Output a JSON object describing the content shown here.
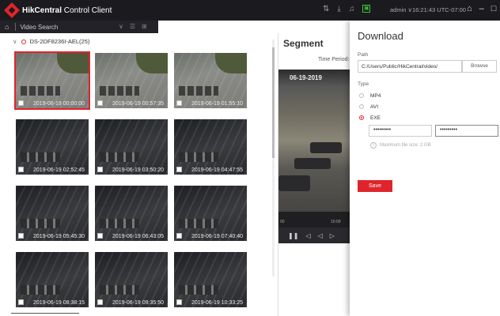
{
  "app": {
    "brand_bold": "HikCentral",
    "brand_rest": " Control Client",
    "user": "admin ∨",
    "time": "16:21:43 UTC-07:00",
    "subtab": "Video Search"
  },
  "tree": {
    "camera": "DS-2DF8236I-AEL(25)"
  },
  "thumbnails": [
    {
      "time": "2019-06-19 00:00:00",
      "style": "day",
      "selected": true
    },
    {
      "time": "2019-06-19 00:57:35",
      "style": "day",
      "selected": false
    },
    {
      "time": "2019-06-19 01:55:10",
      "style": "day",
      "selected": false
    },
    {
      "time": "2019-06-19 02:52:45",
      "style": "night",
      "selected": false
    },
    {
      "time": "2019-06-19 03:50:20",
      "style": "night",
      "selected": false
    },
    {
      "time": "2019-06-19 04:47:55",
      "style": "night",
      "selected": false
    },
    {
      "time": "2019-06-19 05:45:30",
      "style": "night",
      "selected": false
    },
    {
      "time": "2019-06-19 06:43:05",
      "style": "night",
      "selected": false
    },
    {
      "time": "2019-06-19 07:40:40",
      "style": "night",
      "selected": false
    },
    {
      "time": "2019-06-19 08:38:15",
      "style": "night",
      "selected": false
    },
    {
      "time": "2019-06-19 09:35:50",
      "style": "night",
      "selected": false
    },
    {
      "time": "2019-06-19 10:33:25",
      "style": "night",
      "selected": false
    }
  ],
  "segment": {
    "title": "Segment",
    "time_period_label": "Time Period:",
    "video_timestamp": "06-19-2019",
    "timeline_ticks": [
      "00",
      "10:00"
    ]
  },
  "download": {
    "title": "Download",
    "path_label": "Path",
    "path_value": "C:/Users/Public/HikCentral/video/",
    "browse_label": "Browse",
    "type_label": "Type",
    "types": [
      {
        "label": "MP4",
        "selected": false
      },
      {
        "label": "AVI",
        "selected": false
      },
      {
        "label": "EXE",
        "selected": true
      }
    ],
    "password_value": "•••••••••",
    "confirm_value": "•••••••••",
    "max_size": "Maximum file size: 2 GB",
    "save_label": "Save"
  },
  "colors": {
    "accent": "#e0242b",
    "titlebar": "#1b1b1f"
  }
}
